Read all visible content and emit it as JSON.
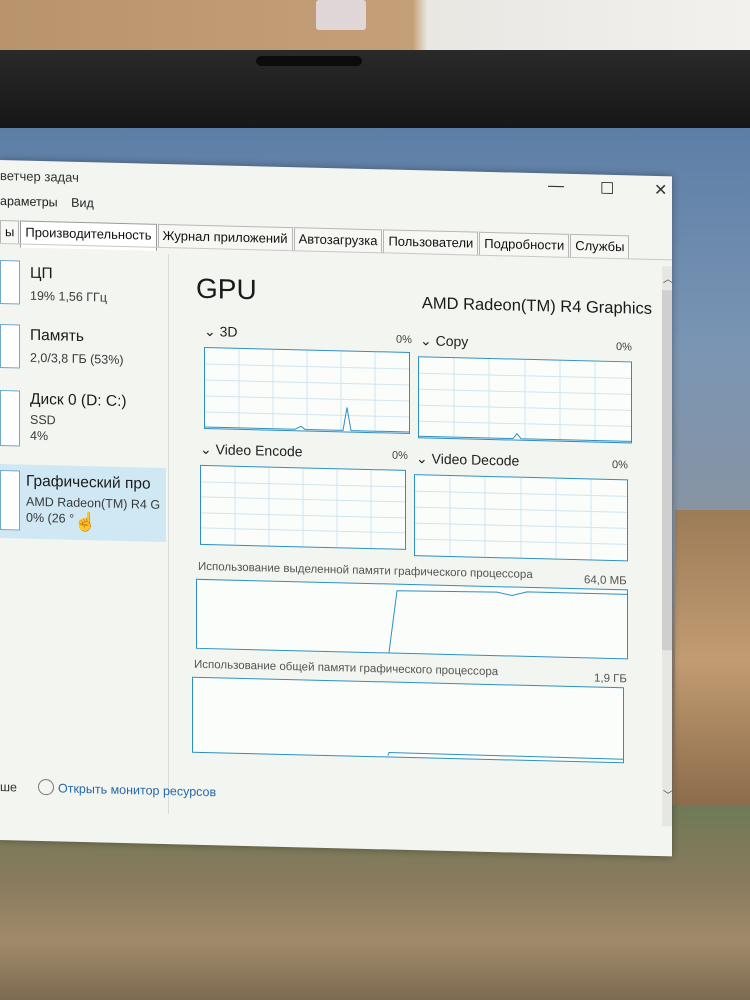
{
  "window": {
    "title": "ветчер задач",
    "menu": [
      "араметры",
      "Вид"
    ],
    "controls": {
      "minimize": "—",
      "maximize": "☐",
      "close": "✕"
    }
  },
  "tabs": [
    {
      "label": "ы",
      "active": false
    },
    {
      "label": "Производительность",
      "active": true
    },
    {
      "label": "Журнал приложений",
      "active": false
    },
    {
      "label": "Автозагрузка",
      "active": false
    },
    {
      "label": "Пользователи",
      "active": false
    },
    {
      "label": "Подробности",
      "active": false
    },
    {
      "label": "Службы",
      "active": false
    }
  ],
  "sidebar": {
    "items": [
      {
        "name": "ЦП",
        "sub1": "19%  1,56 ГГц",
        "sub2": ""
      },
      {
        "name": "Память",
        "sub1": "2,0/3,8 ГБ (53%)",
        "sub2": ""
      },
      {
        "name": "Диск 0 (D: C:)",
        "sub1": "SSD",
        "sub2": "4%"
      },
      {
        "name": "Графический про",
        "sub1": "AMD Radeon(TM) R4 G",
        "sub2": "0% (26 °"
      }
    ]
  },
  "main": {
    "title": "GPU",
    "device_name": "AMD Radeon(TM) R4 Graphics",
    "engines": [
      {
        "label": "3D",
        "percent": "0%"
      },
      {
        "label": "Copy",
        "percent": "0%"
      },
      {
        "label": "Video Encode",
        "percent": "0%"
      },
      {
        "label": "Video Decode",
        "percent": "0%"
      }
    ],
    "dedicated_memory": {
      "label": "Использование выделенной памяти графического процессора",
      "value": "64,0 МБ"
    },
    "shared_memory": {
      "label": "Использование общей памяти графического процессора",
      "value": "1,9 ГБ"
    }
  },
  "footer": {
    "fewer_details": "ше",
    "open_resmon": "Открыть монитор ресурсов"
  },
  "colors": {
    "accent": "#2f8fc2",
    "selected": "#cfe8f3",
    "link": "#2867a8"
  }
}
